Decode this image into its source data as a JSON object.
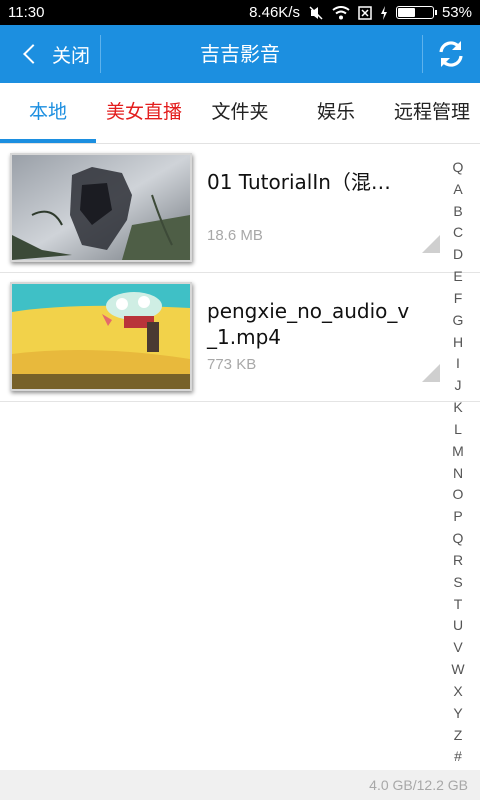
{
  "status_bar": {
    "time": "11:30",
    "net_speed": "8.46K/s",
    "battery_percent": "53%",
    "battery_level": 0.53,
    "icons": [
      "mute-icon",
      "wifi-icon",
      "no-sim-icon",
      "charging-icon",
      "battery-icon"
    ]
  },
  "header": {
    "back_label": "关闭",
    "title": "吉吉影音",
    "accent": "#1c8fe0"
  },
  "tabs": [
    {
      "label": "本地"
    },
    {
      "label": "美女直播"
    },
    {
      "label": "文件夹"
    },
    {
      "label": "娱乐"
    },
    {
      "label": "远程管理"
    }
  ],
  "videos": [
    {
      "name": "01 TutorialIn（混…",
      "size": "18.6 MB"
    },
    {
      "name": "pengxie_no_audio_v_1.mp4",
      "size": "773 KB"
    }
  ],
  "alphabet": [
    "Q",
    "A",
    "B",
    "C",
    "D",
    "E",
    "F",
    "G",
    "H",
    "I",
    "J",
    "K",
    "L",
    "M",
    "N",
    "O",
    "P",
    "Q",
    "R",
    "S",
    "T",
    "U",
    "V",
    "W",
    "X",
    "Y",
    "Z",
    "#"
  ],
  "footer": {
    "storage": "4.0 GB/12.2 GB"
  }
}
